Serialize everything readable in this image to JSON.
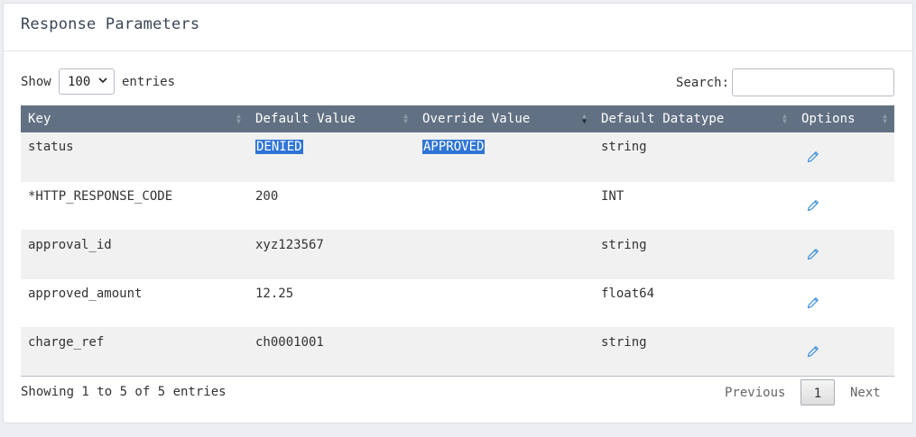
{
  "card": {
    "title": "Response Parameters"
  },
  "length": {
    "show_label": "Show",
    "selected": "100",
    "entries_label": "entries"
  },
  "search": {
    "label": "Search:",
    "value": ""
  },
  "table": {
    "columns": [
      {
        "label": "Key"
      },
      {
        "label": "Default Value"
      },
      {
        "label": "Override Value"
      },
      {
        "label": "Default Datatype"
      },
      {
        "label": "Options"
      }
    ],
    "rows": [
      {
        "key": "status",
        "default_value": "DENIED",
        "override_value": "APPROVED",
        "datatype": "string"
      },
      {
        "key": "*HTTP_RESPONSE_CODE",
        "default_value": "200",
        "override_value": "",
        "datatype": "INT"
      },
      {
        "key": "approval_id",
        "default_value": "xyz123567",
        "override_value": "",
        "datatype": "string"
      },
      {
        "key": "approved_amount",
        "default_value": "12.25",
        "override_value": "",
        "datatype": "float64"
      },
      {
        "key": "charge_ref",
        "default_value": "ch0001001",
        "override_value": "",
        "datatype": "string"
      }
    ],
    "row_action_icon": "pencil-icon"
  },
  "footer": {
    "info": "Showing 1 to 5 of 5 entries",
    "previous": "Previous",
    "current_page": "1",
    "next": "Next"
  },
  "colors": {
    "header_bg": "#627083",
    "highlight": "#2f75d6",
    "edit_icon": "#3c8fd8"
  }
}
